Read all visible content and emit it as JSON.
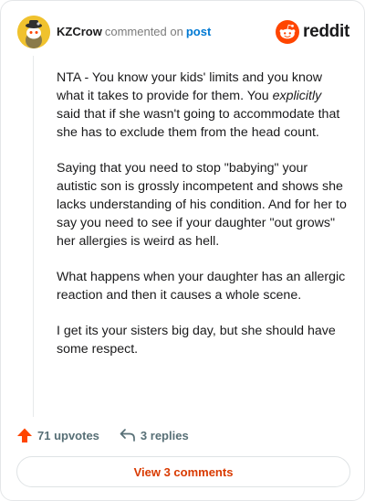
{
  "header": {
    "username": "KZCrow",
    "action": "commented on",
    "post_link": "post",
    "avatar_icon": "snoo-avatar-icon"
  },
  "brand": {
    "name": "reddit",
    "icon": "reddit-logo-icon",
    "color": "#ff4500"
  },
  "comment": {
    "paragraphs": [
      {
        "before": "NTA - You know your kids' limits and you know what it takes to provide for them. You ",
        "emphasis": "explicitly",
        "after": " said that if she wasn't going to accommodate that she has to exclude them from the head count."
      },
      "Saying that you need to stop \"babying\" your autistic son is grossly incompetent and shows she lacks understanding of his condition. And for her to say you need to see if your daughter \"out grows\" her allergies is weird as hell.",
      "What happens when your daughter has an allergic reaction and then it causes a whole scene.",
      "I get its your sisters big day, but she should have some respect."
    ]
  },
  "actions": {
    "upvotes_label": "71 upvotes",
    "upvote_icon": "upvote-arrow-icon",
    "upvote_color": "#ff4500",
    "replies_label": "3 replies",
    "reply_icon": "reply-arrow-icon"
  },
  "footer": {
    "view_comments_label": "View 3 comments",
    "accent_color": "#d93a00"
  }
}
